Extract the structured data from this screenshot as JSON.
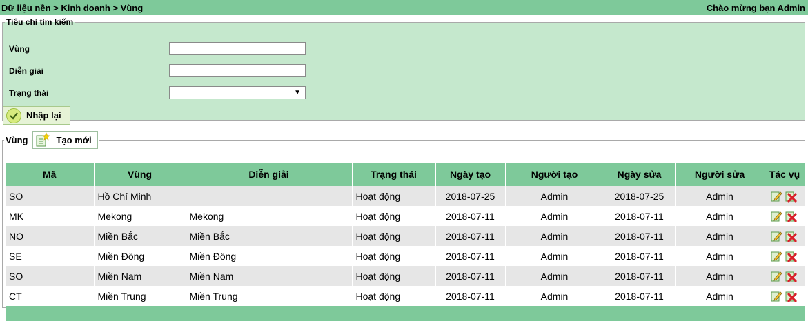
{
  "header": {
    "breadcrumb": "Dữ liệu nền > Kinh doanh > Vùng",
    "welcome": "Chào mừng bạn Admin"
  },
  "search": {
    "legend": "Tiêu chí tìm kiếm",
    "fields": [
      {
        "label": "Vùng",
        "value": ""
      },
      {
        "label": "Diễn giải",
        "value": ""
      },
      {
        "label": "Trạng thái",
        "value": ""
      }
    ],
    "reset_label": "Nhập lại"
  },
  "list": {
    "legend": "Vùng",
    "new_label": "Tạo mới",
    "columns": [
      "Mã",
      "Vùng",
      "Diễn giải",
      "Trạng thái",
      "Ngày tạo",
      "Người tạo",
      "Ngày sửa",
      "Người sửa",
      "Tác vụ"
    ],
    "rows": [
      [
        "SO",
        "Hồ Chí Minh",
        "",
        "Hoạt động",
        "2018-07-25",
        "Admin",
        "2018-07-25",
        "Admin"
      ],
      [
        "MK",
        "Mekong",
        "Mekong",
        "Hoạt động",
        "2018-07-11",
        "Admin",
        "2018-07-11",
        "Admin"
      ],
      [
        "NO",
        "Miền Bắc",
        "Miền Bắc",
        "Hoạt động",
        "2018-07-11",
        "Admin",
        "2018-07-11",
        "Admin"
      ],
      [
        "SE",
        "Miền Đông",
        "Miền Đông",
        "Hoạt động",
        "2018-07-11",
        "Admin",
        "2018-07-11",
        "Admin"
      ],
      [
        "SO",
        "Miền Nam",
        "Miền Nam",
        "Hoạt động",
        "2018-07-11",
        "Admin",
        "2018-07-11",
        "Admin"
      ],
      [
        "CT",
        "Miền Trung",
        "Miền Trung",
        "Hoạt động",
        "2018-07-11",
        "Admin",
        "2018-07-11",
        "Admin"
      ]
    ],
    "row_actions": [
      "edit-icon",
      "delete-icon"
    ]
  },
  "colors": {
    "accent": "#7ec99a",
    "panel": "#c5e8cd",
    "row_alt": "#e6e6e6"
  }
}
